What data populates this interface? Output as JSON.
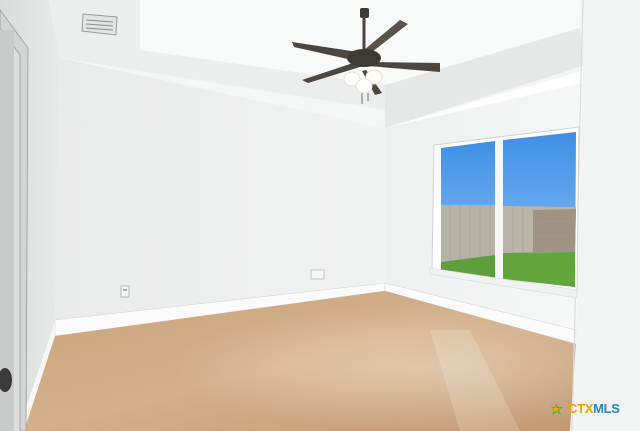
{
  "watermark": {
    "part1": "CTX",
    "part2": "MLS",
    "colors": {
      "primary": "#f0a500",
      "secondary": "#2a86c7",
      "accent": "#4caf50"
    }
  },
  "scene": {
    "elements": [
      "ceiling-fan-icon",
      "air-vent-icon",
      "window",
      "door-frame",
      "electrical-outlet-icon",
      "concrete-floor"
    ]
  }
}
